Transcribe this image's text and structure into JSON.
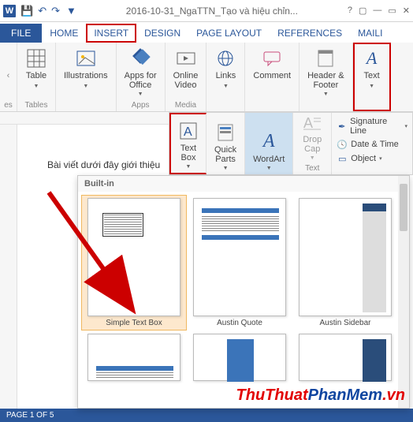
{
  "titlebar": {
    "app_icon": "W",
    "doc_title": "2016-10-31_NgaTTN_Tạo và hiệu chỉn..."
  },
  "tabs": {
    "file": "FILE",
    "items": [
      "HOME",
      "INSERT",
      "DESIGN",
      "PAGE LAYOUT",
      "REFERENCES",
      "MAILI"
    ],
    "active_index": 1
  },
  "ribbon": {
    "pages": {
      "label": "es",
      "group": ""
    },
    "table": {
      "label": "Table",
      "group": "Tables"
    },
    "illustrations": {
      "label": "Illustrations",
      "group": ""
    },
    "apps": {
      "label": "Apps for\nOffice",
      "group": "Apps"
    },
    "video": {
      "label": "Online\nVideo",
      "group": "Media"
    },
    "links": {
      "label": "Links",
      "group": ""
    },
    "comment": {
      "label": "Comment",
      "group": ""
    },
    "header": {
      "label": "Header &\nFooter",
      "group": ""
    },
    "text": {
      "label": "Text",
      "group": ""
    }
  },
  "text_ribbon": {
    "textbox": {
      "label": "Text\nBox"
    },
    "quickparts": {
      "label": "Quick\nParts"
    },
    "wordart": {
      "label": "WordArt"
    },
    "dropcap": {
      "label": "Drop\nCap"
    },
    "sig": "Signature Line",
    "datetime": "Date & Time",
    "object": "Object",
    "group": "Text"
  },
  "body_text": "Bài viết dưới đây giới thiệu",
  "gallery": {
    "header": "Built-in",
    "items": [
      {
        "caption": "Simple Text Box"
      },
      {
        "caption": "Austin Quote"
      },
      {
        "caption": "Austin Sidebar"
      },
      {
        "caption": ""
      },
      {
        "caption": ""
      },
      {
        "caption": ""
      }
    ]
  },
  "statusbar": {
    "page": "PAGE 1 OF 5"
  },
  "watermark": {
    "part1": "ThuThuat",
    "part2": "PhanMem",
    "part3": ".vn"
  }
}
